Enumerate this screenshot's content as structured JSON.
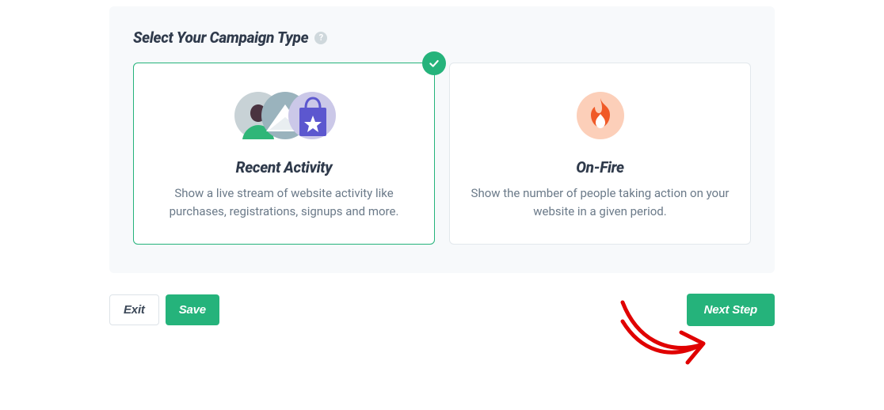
{
  "panel": {
    "title": "Select Your Campaign Type"
  },
  "cards": {
    "recent_activity": {
      "title": "Recent Activity",
      "description": "Show a live stream of website activity like purchases, registrations, signups and more."
    },
    "on_fire": {
      "title": "On-Fire",
      "description": "Show the number of people taking action on your website in a given period."
    }
  },
  "footer": {
    "exit": "Exit",
    "save": "Save",
    "next": "Next Step"
  },
  "colors": {
    "accent": "#25b37b"
  }
}
